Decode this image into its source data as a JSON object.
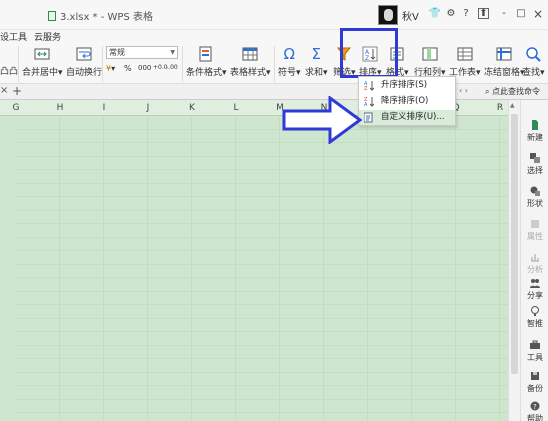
{
  "window": {
    "title": "3.xlsx * - WPS 表格",
    "user": "秋V",
    "controls": [
      "?",
      "-",
      "□",
      "×"
    ]
  },
  "menu": {
    "tab_partial": "设工具",
    "tab_cloud": "云服务"
  },
  "ribbon": {
    "left_partial": "凸凸",
    "merge_center": "合并居中",
    "auto_wrap": "自动换行",
    "number_format": "常规",
    "percent": "%",
    "thousands": "000",
    "decimal_inc": "+0.0",
    "decimal_dec": "-.00",
    "conditional_format": "条件格式",
    "table_style": "表格样式",
    "symbol": "符号",
    "sum": "求和",
    "filter": "筛选",
    "sort": "排序",
    "format": "格式",
    "rows_cols": "行和列",
    "worksheet": "工作表",
    "freeze": "冻结窗格",
    "find": "查找",
    "dropdown_caret": "▾"
  },
  "sheetbar": {
    "close": "×",
    "add": "+",
    "search_placeholder": "点此查找命令",
    "nav": "‹ ›"
  },
  "columns": [
    "G",
    "H",
    "I",
    "J",
    "K",
    "L",
    "M",
    "N",
    "O",
    "P",
    "Q",
    "R"
  ],
  "sidepanel": [
    {
      "label": "新建",
      "icon": "new-icon",
      "enabled": true
    },
    {
      "label": "选择",
      "icon": "select-icon",
      "enabled": true
    },
    {
      "label": "形状",
      "icon": "shape-icon",
      "enabled": true
    },
    {
      "label": "属性",
      "icon": "properties-icon",
      "enabled": false
    },
    {
      "label": "分析",
      "icon": "analysis-icon",
      "enabled": false
    },
    {
      "label": "分享",
      "icon": "share-icon",
      "enabled": true
    },
    {
      "label": "智推",
      "icon": "smart-push-icon",
      "enabled": true
    },
    {
      "label": "工具",
      "icon": "tools-icon",
      "enabled": true
    },
    {
      "label": "备份",
      "icon": "backup-icon",
      "enabled": true
    },
    {
      "label": "帮助",
      "icon": "help-icon",
      "enabled": true
    }
  ],
  "sort_menu": {
    "items": [
      {
        "label": "升序排序(S)",
        "icon": "sort-ascending-icon",
        "highlighted": false
      },
      {
        "label": "降序排序(O)",
        "icon": "sort-descending-icon",
        "highlighted": false
      },
      {
        "label": "自定义排序(U)...",
        "icon": "custom-sort-icon",
        "highlighted": true
      }
    ]
  },
  "colors": {
    "grid_bg": "#cde6cd",
    "highlight_box": "#2f3ad6",
    "menu_highlight": "#d9ecd9",
    "accent_green": "#2e8b57"
  }
}
